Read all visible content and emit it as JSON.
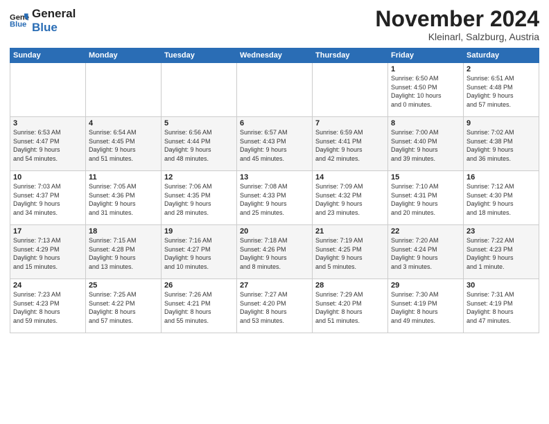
{
  "logo": {
    "line1": "General",
    "line2": "Blue"
  },
  "title": "November 2024",
  "subtitle": "Kleinarl, Salzburg, Austria",
  "days_of_week": [
    "Sunday",
    "Monday",
    "Tuesday",
    "Wednesday",
    "Thursday",
    "Friday",
    "Saturday"
  ],
  "weeks": [
    [
      {
        "day": "",
        "info": ""
      },
      {
        "day": "",
        "info": ""
      },
      {
        "day": "",
        "info": ""
      },
      {
        "day": "",
        "info": ""
      },
      {
        "day": "",
        "info": ""
      },
      {
        "day": "1",
        "info": "Sunrise: 6:50 AM\nSunset: 4:50 PM\nDaylight: 10 hours\nand 0 minutes."
      },
      {
        "day": "2",
        "info": "Sunrise: 6:51 AM\nSunset: 4:48 PM\nDaylight: 9 hours\nand 57 minutes."
      }
    ],
    [
      {
        "day": "3",
        "info": "Sunrise: 6:53 AM\nSunset: 4:47 PM\nDaylight: 9 hours\nand 54 minutes."
      },
      {
        "day": "4",
        "info": "Sunrise: 6:54 AM\nSunset: 4:45 PM\nDaylight: 9 hours\nand 51 minutes."
      },
      {
        "day": "5",
        "info": "Sunrise: 6:56 AM\nSunset: 4:44 PM\nDaylight: 9 hours\nand 48 minutes."
      },
      {
        "day": "6",
        "info": "Sunrise: 6:57 AM\nSunset: 4:43 PM\nDaylight: 9 hours\nand 45 minutes."
      },
      {
        "day": "7",
        "info": "Sunrise: 6:59 AM\nSunset: 4:41 PM\nDaylight: 9 hours\nand 42 minutes."
      },
      {
        "day": "8",
        "info": "Sunrise: 7:00 AM\nSunset: 4:40 PM\nDaylight: 9 hours\nand 39 minutes."
      },
      {
        "day": "9",
        "info": "Sunrise: 7:02 AM\nSunset: 4:38 PM\nDaylight: 9 hours\nand 36 minutes."
      }
    ],
    [
      {
        "day": "10",
        "info": "Sunrise: 7:03 AM\nSunset: 4:37 PM\nDaylight: 9 hours\nand 34 minutes."
      },
      {
        "day": "11",
        "info": "Sunrise: 7:05 AM\nSunset: 4:36 PM\nDaylight: 9 hours\nand 31 minutes."
      },
      {
        "day": "12",
        "info": "Sunrise: 7:06 AM\nSunset: 4:35 PM\nDaylight: 9 hours\nand 28 minutes."
      },
      {
        "day": "13",
        "info": "Sunrise: 7:08 AM\nSunset: 4:33 PM\nDaylight: 9 hours\nand 25 minutes."
      },
      {
        "day": "14",
        "info": "Sunrise: 7:09 AM\nSunset: 4:32 PM\nDaylight: 9 hours\nand 23 minutes."
      },
      {
        "day": "15",
        "info": "Sunrise: 7:10 AM\nSunset: 4:31 PM\nDaylight: 9 hours\nand 20 minutes."
      },
      {
        "day": "16",
        "info": "Sunrise: 7:12 AM\nSunset: 4:30 PM\nDaylight: 9 hours\nand 18 minutes."
      }
    ],
    [
      {
        "day": "17",
        "info": "Sunrise: 7:13 AM\nSunset: 4:29 PM\nDaylight: 9 hours\nand 15 minutes."
      },
      {
        "day": "18",
        "info": "Sunrise: 7:15 AM\nSunset: 4:28 PM\nDaylight: 9 hours\nand 13 minutes."
      },
      {
        "day": "19",
        "info": "Sunrise: 7:16 AM\nSunset: 4:27 PM\nDaylight: 9 hours\nand 10 minutes."
      },
      {
        "day": "20",
        "info": "Sunrise: 7:18 AM\nSunset: 4:26 PM\nDaylight: 9 hours\nand 8 minutes."
      },
      {
        "day": "21",
        "info": "Sunrise: 7:19 AM\nSunset: 4:25 PM\nDaylight: 9 hours\nand 5 minutes."
      },
      {
        "day": "22",
        "info": "Sunrise: 7:20 AM\nSunset: 4:24 PM\nDaylight: 9 hours\nand 3 minutes."
      },
      {
        "day": "23",
        "info": "Sunrise: 7:22 AM\nSunset: 4:23 PM\nDaylight: 9 hours\nand 1 minute."
      }
    ],
    [
      {
        "day": "24",
        "info": "Sunrise: 7:23 AM\nSunset: 4:23 PM\nDaylight: 8 hours\nand 59 minutes."
      },
      {
        "day": "25",
        "info": "Sunrise: 7:25 AM\nSunset: 4:22 PM\nDaylight: 8 hours\nand 57 minutes."
      },
      {
        "day": "26",
        "info": "Sunrise: 7:26 AM\nSunset: 4:21 PM\nDaylight: 8 hours\nand 55 minutes."
      },
      {
        "day": "27",
        "info": "Sunrise: 7:27 AM\nSunset: 4:20 PM\nDaylight: 8 hours\nand 53 minutes."
      },
      {
        "day": "28",
        "info": "Sunrise: 7:29 AM\nSunset: 4:20 PM\nDaylight: 8 hours\nand 51 minutes."
      },
      {
        "day": "29",
        "info": "Sunrise: 7:30 AM\nSunset: 4:19 PM\nDaylight: 8 hours\nand 49 minutes."
      },
      {
        "day": "30",
        "info": "Sunrise: 7:31 AM\nSunset: 4:19 PM\nDaylight: 8 hours\nand 47 minutes."
      }
    ]
  ]
}
